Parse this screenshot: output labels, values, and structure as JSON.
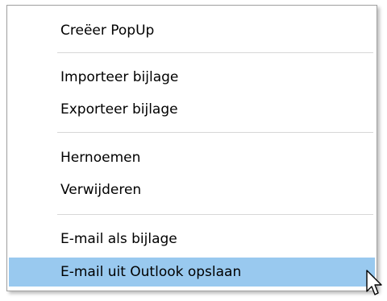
{
  "context_menu": {
    "items": [
      {
        "label": "Creëer PopUp"
      },
      {
        "label": "Importeer bijlage"
      },
      {
        "label": "Exporteer bijlage"
      },
      {
        "label": "Hernoemen"
      },
      {
        "label": "Verwijderen"
      },
      {
        "label": "E-mail als bijlage"
      },
      {
        "label": "E-mail uit Outlook opslaan"
      }
    ],
    "highlight_color": "#99c9ef",
    "highlighted_item": "E-mail uit Outlook opslaan"
  },
  "pointer": {
    "icon": "arrow-cursor-icon"
  }
}
